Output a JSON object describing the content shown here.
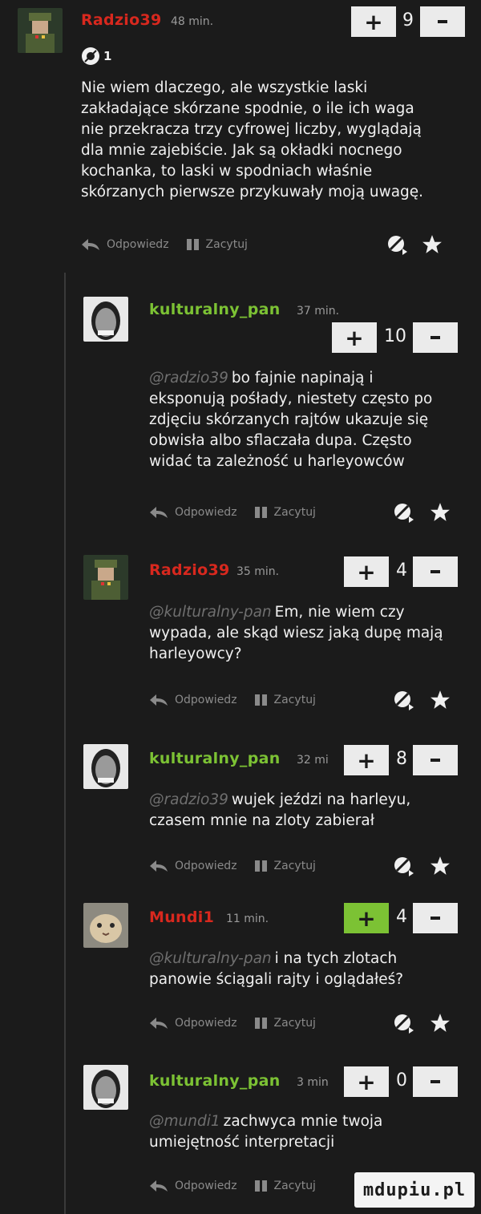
{
  "colors": {
    "background": "#1b1b1b",
    "username_red": "#d8281e",
    "username_green": "#7cc234",
    "plus_active": "#7cc234"
  },
  "actions": {
    "reply": "Odpowiedz",
    "quote": "Zacytuj"
  },
  "comments": [
    {
      "user": "Radzio39",
      "time": "48 min.",
      "votes": "9",
      "media_count": "1",
      "mention": "",
      "lines": [
        "Nie wiem dlaczego, ale wszystkie laski",
        "zakładające skórzane spodnie, o ile ich waga",
        "nie przekracza trzy cyfrowej liczby, wyglądają",
        "dla mnie zajebiście. Jak są okładki nocnego",
        "kochanka, to laski w spodniach właśnie",
        "skórzanych pierwsze przykuwały moją uwagę."
      ]
    },
    {
      "user": "kulturalny_pan",
      "time": "37 min.",
      "votes": "10",
      "mention": "@radzio39",
      "lines": [
        "bo fajnie napinają i",
        "eksponują pośłady, niestety często po",
        "zdjęciu skórzanych rajtów ukazuje się",
        "obwisła albo sflaczała dupa. Często",
        "widać ta zależność u harleyowców"
      ]
    },
    {
      "user": "Radzio39",
      "time": "35 min.",
      "votes": "4",
      "mention": "@kulturalny-pan",
      "lines": [
        "Em, nie wiem czy",
        "wypada, ale skąd wiesz jaką dupę mają",
        "harleyowcy?"
      ]
    },
    {
      "user": "kulturalny_pan",
      "time": "32 mi",
      "votes": "8",
      "mention": "@radzio39",
      "lines": [
        "wujek jeździ na harleyu,",
        "czasem mnie na zloty zabierał"
      ]
    },
    {
      "user": "Mundi1",
      "time": "11 min.",
      "votes": "4",
      "mention": "@kulturalny-pan",
      "lines": [
        "i na tych zlotach",
        "panowie ściągali rajty i oglądałeś?"
      ]
    },
    {
      "user": "kulturalny_pan",
      "time": "3 min",
      "votes": "0",
      "mention": "@mundi1",
      "lines": [
        "zachwyca mnie twoja",
        "umiejętność interpretacji"
      ]
    }
  ],
  "watermark": "mdupiu.pl"
}
